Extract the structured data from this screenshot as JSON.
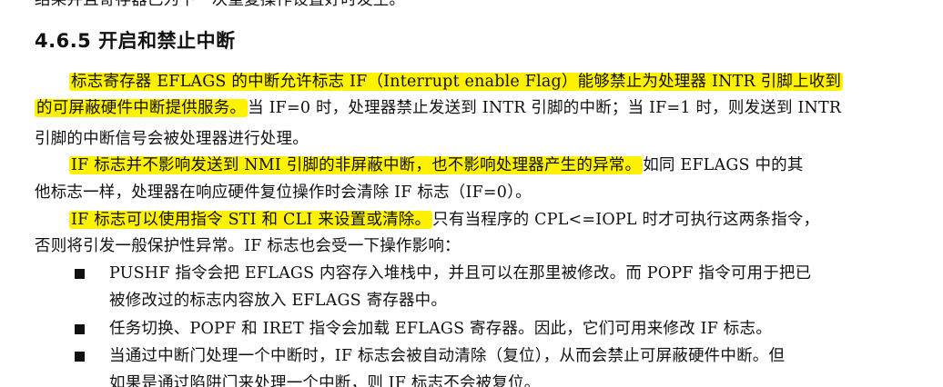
{
  "doc": {
    "top_line": "结果并且寄存器已为下一次重复操作设置好时发生。",
    "heading": "4.6.5 开启和禁止中断",
    "para1": {
      "line1_hl": "标志寄存器 EFLAGS 的中断允许标志 IF（Interrupt enable Flag）能够禁止为处理器 INTR 引脚上收到",
      "line2_hl": "的可屏蔽硬件中断提供服务。",
      "line2_rest": "当 IF=0 时，处理器禁止发送到 INTR 引脚的中断；当 IF=1 时，则发送到 INTR",
      "line3": "引脚的中断信号会被处理器进行处理。"
    },
    "para2": {
      "line1_hl": "IF 标志并不影响发送到 NMI 引脚的非屏蔽中断，也不影响处理器产生的异常。",
      "line1_rest": "如同 EFLAGS 中的其",
      "line2": "他标志一样，处理器在响应硬件复位操作时会清除 IF 标志（IF=0）。"
    },
    "para3": {
      "line1_hl": "IF 标志可以使用指令 STI 和 CLI 来设置或清除。",
      "line1_rest": "只有当程序的 CPL<=IOPL 时才可执行这两条指令，",
      "line2": "否则将引发一般保护性异常。IF 标志也会受一下操作影响："
    },
    "bullets": [
      {
        "line1": "PUSHF 指令会把 EFLAGS 内容存入堆栈中，并且可以在那里被修改。而 POPF 指令可用于把已",
        "line2": "被修改过的标志内容放入 EFLAGS 寄存器中。"
      },
      {
        "line1": "任务切换、POPF 和 IRET 指令会加载 EFLAGS 寄存器。因此，它们可用来修改 IF 标志。"
      },
      {
        "line1": "当通过中断门处理一个中断时，IF 标志会被自动清除（复位），从而会禁止可屏蔽硬件中断。但",
        "line2": "如果是通过陷阱门来处理一个中断，则 IF 标志不会被复位。"
      }
    ],
    "highlight_color": "#fff200"
  }
}
